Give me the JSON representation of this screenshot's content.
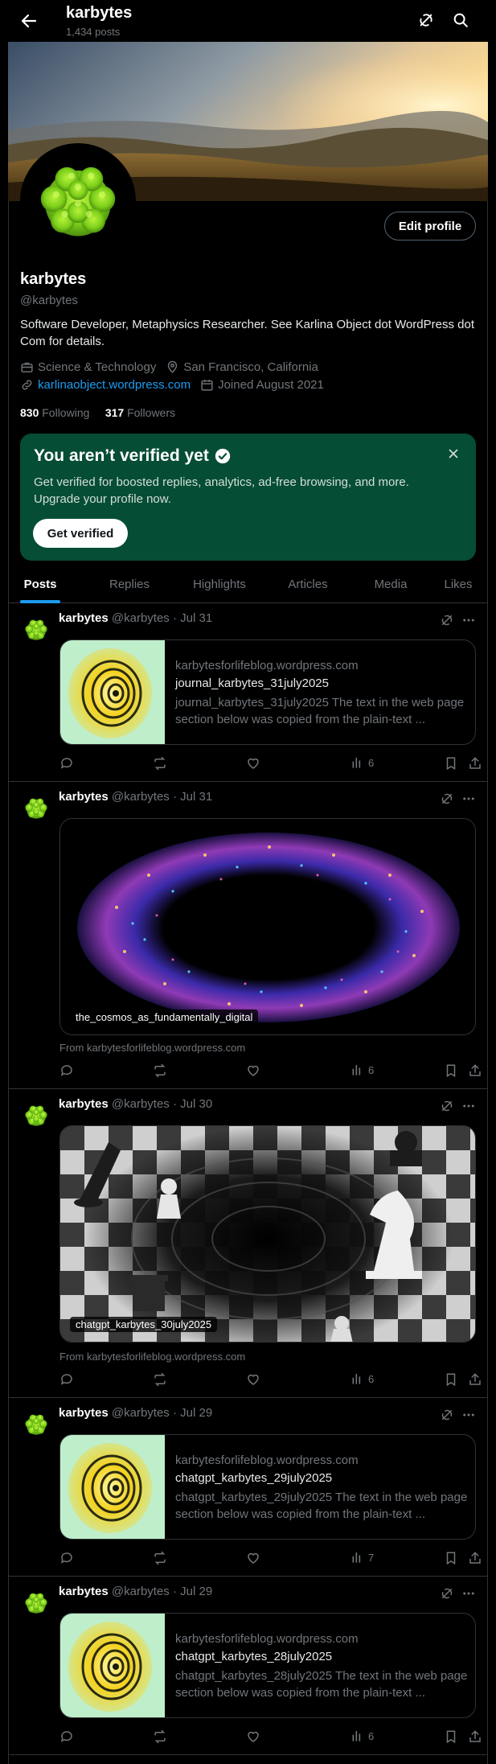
{
  "header": {
    "title": "karbytes",
    "post_count": "1,434 posts"
  },
  "profile": {
    "edit_label": "Edit profile",
    "name": "karbytes",
    "handle": "@karbytes",
    "bio": "Software Developer, Metaphysics Researcher. See Karlina Object dot WordPress dot Com for details.",
    "category": "Science & Technology",
    "location": "San Francisco, California",
    "website": "karlinaobject.wordpress.com",
    "joined": "Joined August 2021",
    "following_count": "830",
    "following_label": "Following",
    "followers_count": "317",
    "followers_label": "Followers"
  },
  "verify": {
    "title": "You aren’t verified yet",
    "desc": "Get verified for boosted replies, analytics, ad-free browsing, and more. Upgrade your profile now.",
    "button": "Get verified",
    "bg_color": "#064d35"
  },
  "tabs": [
    "Posts",
    "Replies",
    "Highlights",
    "Articles",
    "Media",
    "Likes"
  ],
  "colors": {
    "accent": "#1d9bf0",
    "muted": "#71767b",
    "border": "#2f3336"
  },
  "posts": [
    {
      "name": "karbytes",
      "handle": "@karbytes",
      "date": "Jul 31",
      "card": {
        "domain": "karbytesforlifeblog.wordpress.com",
        "title": "journal_karbytes_31july2025",
        "desc": "journal_karbytes_31july2025 The text in the web page section below was copied from the plain-text ..."
      },
      "views": "6"
    },
    {
      "name": "karbytes",
      "handle": "@karbytes",
      "date": "Jul 31",
      "media_caption": "the_cosmos_as_fundamentally_digital",
      "from": "From karbytesforlifeblog.wordpress.com",
      "views": "6"
    },
    {
      "name": "karbytes",
      "handle": "@karbytes",
      "date": "Jul 30",
      "media_caption": "chatgpt_karbytes_30july2025",
      "from": "From karbytesforlifeblog.wordpress.com",
      "views": "6"
    },
    {
      "name": "karbytes",
      "handle": "@karbytes",
      "date": "Jul 29",
      "card": {
        "domain": "karbytesforlifeblog.wordpress.com",
        "title": "chatgpt_karbytes_29july2025",
        "desc": "chatgpt_karbytes_29july2025 The text in the web page section below was copied from the plain-text ..."
      },
      "views": "7"
    },
    {
      "name": "karbytes",
      "handle": "@karbytes",
      "date": "Jul 29",
      "card": {
        "domain": "karbytesforlifeblog.wordpress.com",
        "title": "chatgpt_karbytes_28july2025",
        "desc": "chatgpt_karbytes_28july2025 The text in the web page section below was copied from the plain-text ..."
      },
      "views": "6"
    }
  ]
}
